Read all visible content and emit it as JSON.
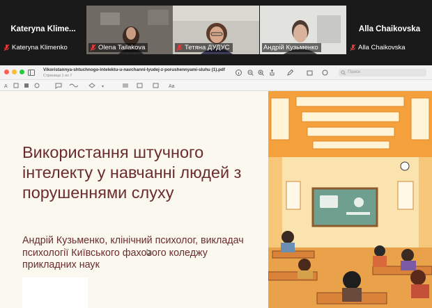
{
  "participants": [
    {
      "big_name": "Kateryna  Klime...",
      "caption": "Kateryna Klimenko",
      "video": false
    },
    {
      "big_name": "",
      "caption": "Olena Tailakova",
      "video": true
    },
    {
      "big_name": "",
      "caption": "Тетяна ДУДУС",
      "video": true
    },
    {
      "big_name": "",
      "caption": "Андрій Кузьменко",
      "video": true,
      "active": true
    },
    {
      "big_name": "Alla Chaikovska",
      "caption": "Alla Chaikovska",
      "video": false
    }
  ],
  "viewer": {
    "file_name": "Vikoristannya-shtuchnogo-intelektu-u-navchanni-lyudej-z-porushennyami-sluhu (1).pdf",
    "page_info": "Страница 1 из 7",
    "search_placeholder": "Поиск"
  },
  "slide": {
    "title": "Використання штучного інтелекту у навчанні людей з порушеннями слуху",
    "subtitle": "Андрій Кузьменко, клінічний психолог, викладач психології Київського фахового коледжу прикладних наук"
  },
  "colors": {
    "title_text": "#6a2c2c",
    "slide_bg": "#fbf8ef",
    "active_speaker": "#4cd964",
    "mic_muted": "#e23b3b"
  },
  "icons": [
    "mic-muted-icon",
    "sidebar-icon",
    "zoom-icon",
    "share-icon",
    "markup-icon",
    "search-icon"
  ]
}
